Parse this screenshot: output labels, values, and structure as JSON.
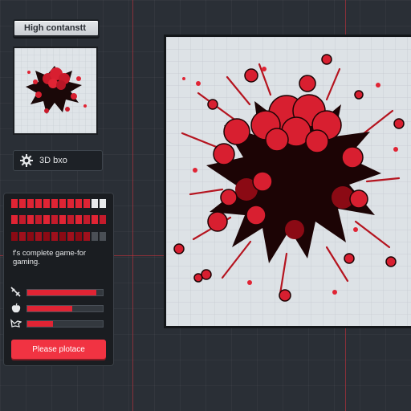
{
  "mode_button": {
    "label": "High contanstt"
  },
  "toggle_3d": {
    "label": "3D bxo"
  },
  "panel": {
    "description": "f's complete game-for gaming.",
    "stats": [
      {
        "level": 0.92
      },
      {
        "level": 0.6
      },
      {
        "level": 0.34
      }
    ],
    "cta_label": "Please plotace"
  },
  "colors": {
    "accent": "#e02434",
    "dark_red": "#8b0a14",
    "background": "#2a2f36",
    "canvas": "#dde2e6"
  },
  "icons": [
    "gear-icon",
    "sword-icon",
    "apple-icon",
    "bird-icon"
  ]
}
